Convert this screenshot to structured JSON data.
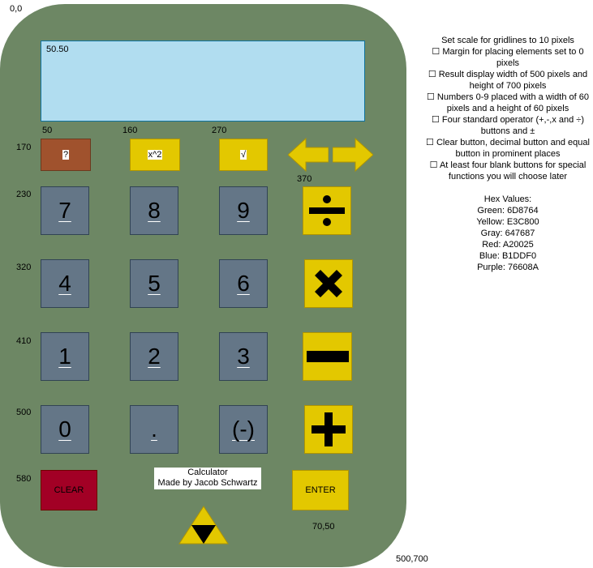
{
  "coords": {
    "origin": "0,0",
    "display_label": "50.50",
    "col1": "50",
    "col2": "160",
    "col3": "270",
    "col4": "370",
    "row_top": "170",
    "row1": "230",
    "row2": "320",
    "row3": "410",
    "row4": "500",
    "row5": "580",
    "enter_size": "70,50",
    "body_size": "500,700"
  },
  "buttons": {
    "unknown": "?",
    "square": "x^2",
    "sqrt": "√",
    "n7": "7",
    "n8": "8",
    "n9": "9",
    "n4": "4",
    "n5": "5",
    "n6": "6",
    "n1": "1",
    "n2": "2",
    "n3": "3",
    "n0": "0",
    "decimal": ".",
    "negate": "(-)",
    "clear": "CLEAR",
    "enter": "ENTER"
  },
  "credit": {
    "line1": "Calculator",
    "line2": "Made by Jacob Schwartz"
  },
  "notes": {
    "items": [
      "Set scale for gridlines to 10 pixels",
      "☐ Margin for placing elements set to 0 pixels",
      "☐ Result display width of 500 pixels and height of 700 pixels",
      "☐ Numbers 0-9 placed with a width of 60 pixels and a height of 60 pixels",
      "☐ Four standard operator (+,-,x and ÷) buttons and ±",
      "☐ Clear button, decimal button and equal button in prominent places",
      "☐ At least four blank buttons for special functions you will choose later"
    ],
    "hex_title": "Hex Values:",
    "hex": [
      "Green: 6D8764",
      "Yellow: E3C800",
      "Gray: 647687",
      "Red: A20025",
      "Blue: B1DDF0",
      "Purple: 76608A"
    ]
  },
  "colors": {
    "green": "#6D8764",
    "yellow": "#E3C800",
    "gray": "#647687",
    "red": "#A20025",
    "blue": "#B1DDF0",
    "brown": "#A0522D"
  },
  "icons": {
    "left_arrow": "arrow-left-icon",
    "right_arrow": "arrow-right-icon",
    "divide": "divide-icon",
    "multiply": "multiply-icon",
    "minus": "minus-icon",
    "plus": "plus-icon",
    "triforce": "triforce-icon"
  }
}
